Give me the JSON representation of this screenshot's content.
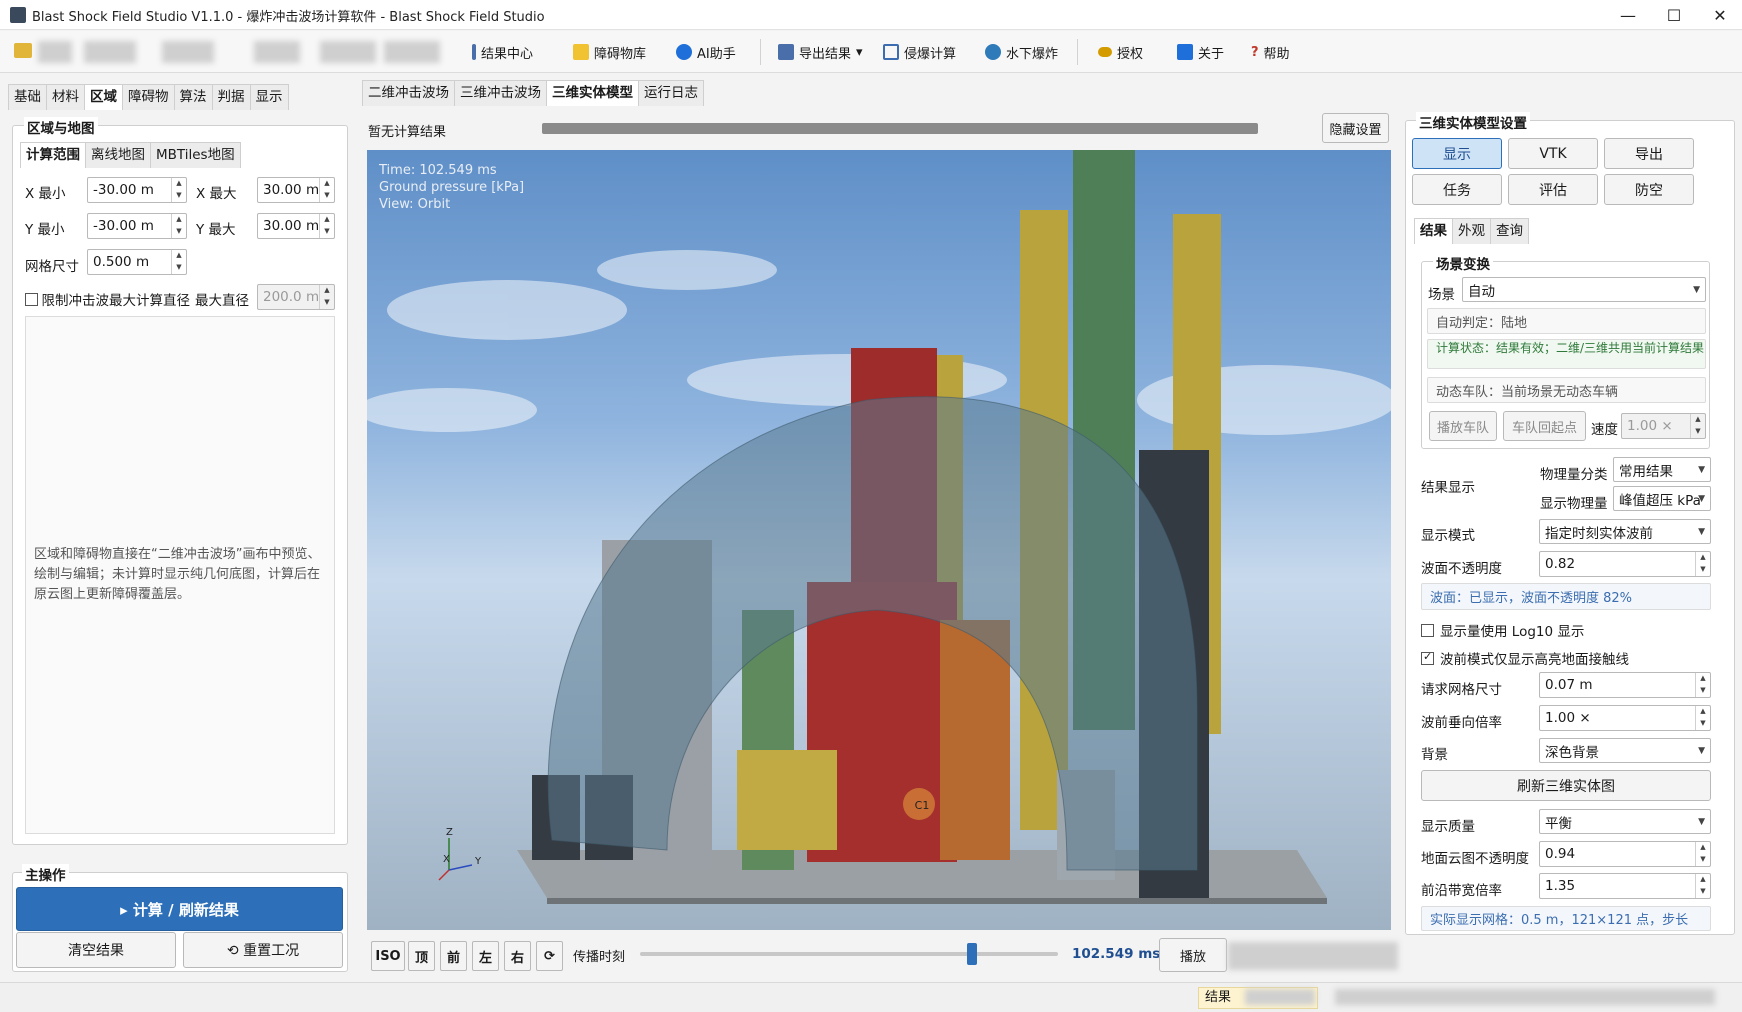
{
  "window": {
    "title": "Blast Shock Field Studio V1.1.0 - 爆炸冲击波场计算软件 - Blast Shock Field Studio",
    "controls": [
      "—",
      "☐",
      "✕"
    ]
  },
  "toolbar": {
    "items": [
      {
        "label": "结果中心",
        "icon": "results-center-icon",
        "color": "#4a6ea9"
      },
      {
        "label": "障碍物库",
        "icon": "obstacle-library-icon",
        "color": "#f1c232"
      },
      {
        "label": "AI助手",
        "icon": "ai-assistant-icon",
        "color": "#1e6fd9"
      },
      {
        "label": "导出结果",
        "icon": "export-results-icon",
        "color": "#4a6ea9",
        "dropdown": "▾"
      },
      {
        "label": "侵爆计算",
        "icon": "penetration-calc-icon",
        "color": "#3b6db0"
      },
      {
        "label": "水下爆炸",
        "icon": "underwater-blast-icon",
        "color": "#2f7ab8"
      },
      {
        "label": "授权",
        "icon": "license-key-icon",
        "color": "#d49b00"
      },
      {
        "label": "关于",
        "icon": "about-info-icon",
        "color": "#1e6fd9"
      },
      {
        "label": "帮助",
        "icon": "help-icon",
        "color": "#c0392b"
      }
    ]
  },
  "left": {
    "tabs": [
      "基础",
      "材料",
      "区域",
      "障碍物",
      "算法",
      "判据",
      "显示"
    ],
    "active_tab": "区域",
    "group_title": "区域与地图",
    "subtabs": [
      "计算范围",
      "离线地图",
      "MBTiles地图"
    ],
    "x_min_label": "X 最小",
    "x_min": "-30.00 m",
    "x_max_label": "X 最大",
    "x_max": "30.00 m",
    "y_min_label": "Y 最小",
    "y_min": "-30.00 m",
    "y_max_label": "Y 最大",
    "y_max": "30.00 m",
    "grid_label": "网格尺寸",
    "grid": "0.500 m",
    "limit_label": "限制冲击波最大计算直径",
    "limit_checked": false,
    "maxdia_label": "最大直径",
    "maxdia": "200.0 m",
    "info": "区域和障碍物直接在“二维冲击波场”画布中预览、绘制与编辑；未计算时显示纯几何底图，计算后在原云图上更新障碍覆盖层。",
    "main_title": "主操作",
    "compute_btn": "▸ 计算 / 刷新结果",
    "clear_btn": "清空结果",
    "reset_btn": "⟲ 重置工况"
  },
  "center": {
    "tabs": [
      "二维冲击波场",
      "三维冲击波场",
      "三维实体模型",
      "运行日志"
    ],
    "active_tab": "三维实体模型",
    "status": "暂无计算结果",
    "hide_btn": "隐藏设置",
    "overlay": [
      "Time: 102.549 ms",
      "Ground pressure [kPa]",
      "View: Orbit"
    ],
    "marker": "C1",
    "axes": {
      "z": "Z",
      "x": "X",
      "y": "Y"
    },
    "view_buttons": [
      "ISO",
      "顶",
      "前",
      "左",
      "右",
      "⟳"
    ],
    "time_label": "传播时刻",
    "time_value": "102.549 ms",
    "time_fraction": 0.795,
    "play_btn": "播放"
  },
  "right": {
    "group_title": "三维实体模型设置",
    "buttons": [
      "显示",
      "VTK",
      "导出",
      "任务",
      "评估",
      "防空"
    ],
    "active_button": "显示",
    "subtabs": [
      "结果",
      "外观",
      "查询"
    ],
    "scene_group": "场景变换",
    "scene_label": "场景",
    "scene_value": "自动",
    "auto_judge": "自动判定：陆地",
    "calc_status": "计算状态：结果有效；二维/三维共用当前计算结果",
    "fleet": "动态车队：当前场景无动态车辆",
    "play_fleet": "播放车队",
    "fleet_reset": "车队回起点",
    "speed_label": "速度",
    "speed_value": "1.00 ×",
    "result_display_label": "结果显示",
    "phys_cat_label": "物理量分类",
    "phys_cat_value": "常用结果",
    "phys_qty_label": "显示物理量",
    "phys_qty_value": "峰值超压 kPa",
    "mode_label": "显示模式",
    "mode_value": "指定时刻实体波前",
    "opacity_label": "波面不透明度",
    "opacity_value": "0.82",
    "wave_status": "波面：已显示，波面不透明度 82%",
    "log10_label": "显示量使用 Log10 显示",
    "log10_checked": false,
    "front_label": "波前模式仅显示高亮地面接触线",
    "front_checked": true,
    "req_grid_label": "请求网格尺寸",
    "req_grid_value": "0.07 m",
    "vert_label": "波前垂向倍率",
    "vert_value": "1.00 ×",
    "bg_label": "背景",
    "bg_value": "深色背景",
    "refresh_btn": "刷新三维实体图",
    "quality_label": "显示质量",
    "quality_value": "平衡",
    "ground_label": "地面云图不透明度",
    "ground_value": "0.94",
    "band_label": "前沿带宽倍率",
    "band_value": "1.35",
    "actual_grid": "实际显示网格：0.5 m，121×121 点，步长"
  },
  "statusbar": {
    "left": "结果"
  },
  "colors": {
    "accent": "#2d6fb8",
    "active_btn": "#cfe3f7"
  }
}
